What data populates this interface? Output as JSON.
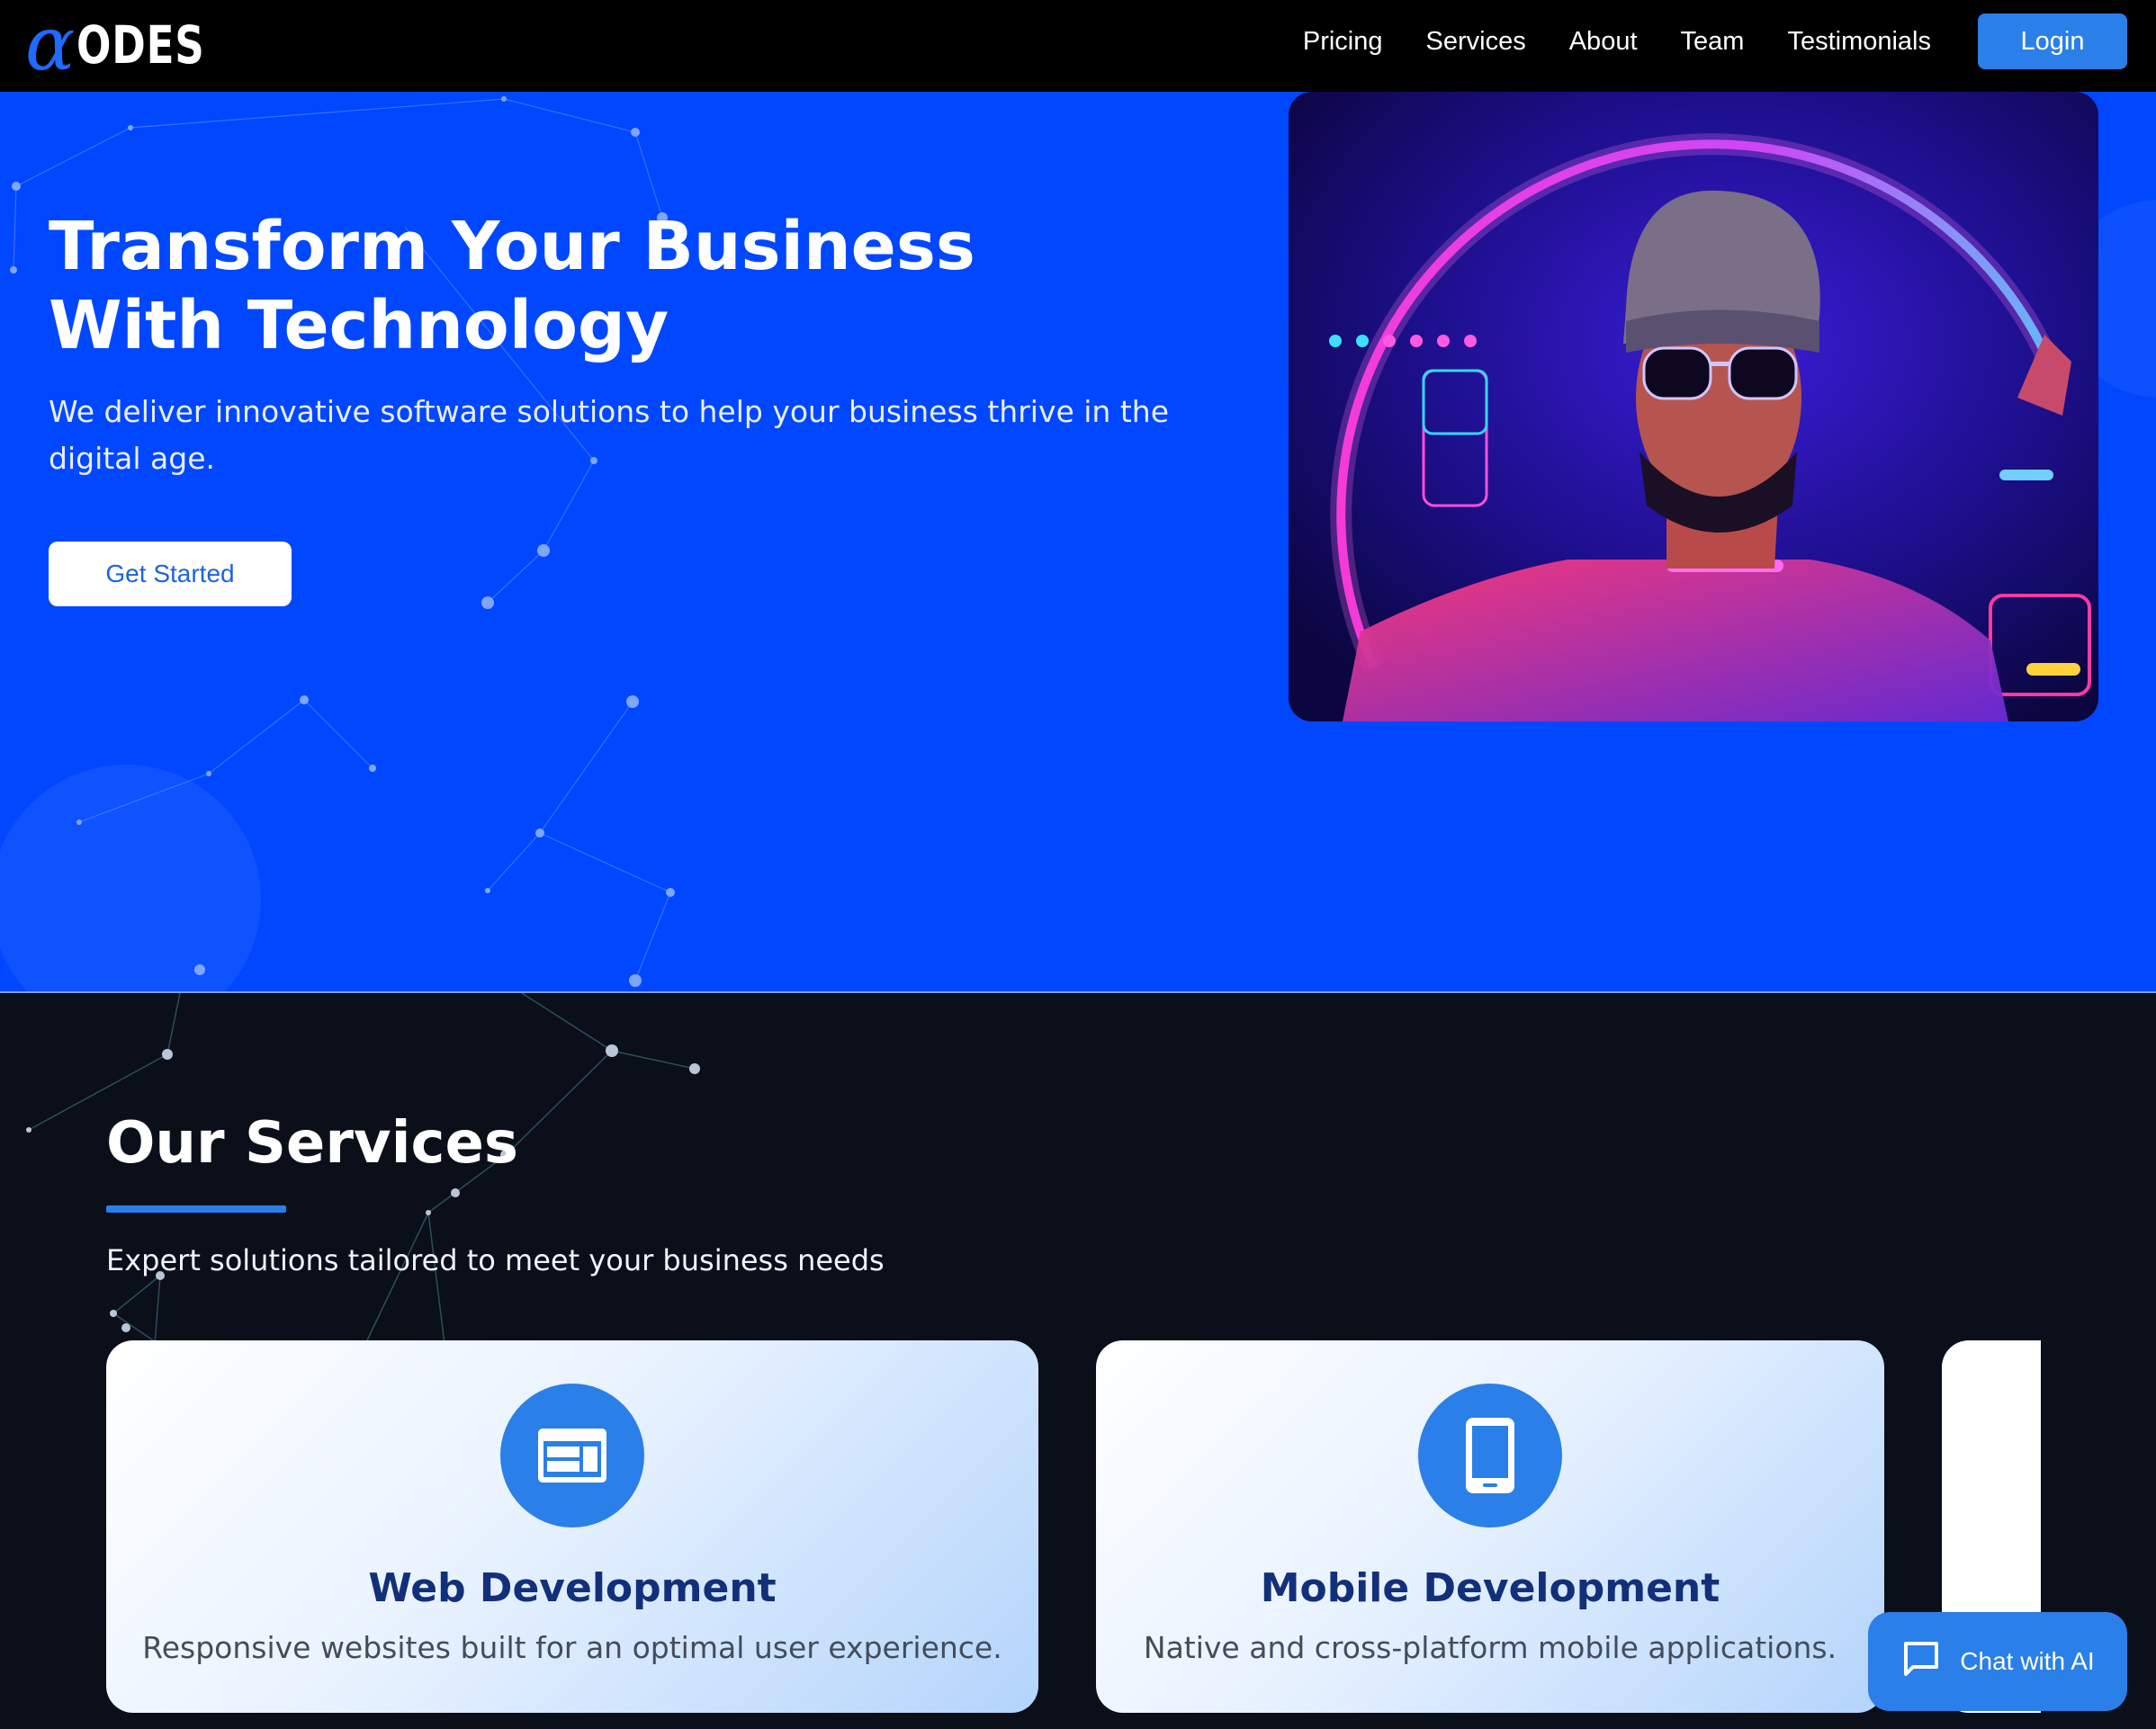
{
  "nav": {
    "logo_word": "ODES",
    "links": [
      "Pricing",
      "Services",
      "About",
      "Team",
      "Testimonials"
    ],
    "login_label": "Login"
  },
  "hero": {
    "title_line1": "Transform Your Business",
    "title_line2": "With Technology",
    "subtitle": "We deliver innovative software solutions to help your business thrive in the digital age.",
    "cta_label": "Get Started"
  },
  "services": {
    "title": "Our Services",
    "subtitle": "Expert solutions tailored to meet your business needs",
    "cards": [
      {
        "name": "Web Development",
        "desc": "Responsive websites built for an optimal user experience.",
        "icon": "browser-window-icon"
      },
      {
        "name": "Mobile Development",
        "desc": "Native and cross-platform mobile applications.",
        "icon": "smartphone-icon"
      }
    ]
  },
  "chat": {
    "label": "Chat with AI",
    "icon": "chat-bubble-icon"
  },
  "colors": {
    "nav_bg": "#000000",
    "hero_bg": "#0047ff",
    "accent": "#2a7fe8",
    "dark_bg": "#0a0f1a",
    "card_title": "#12307a"
  }
}
